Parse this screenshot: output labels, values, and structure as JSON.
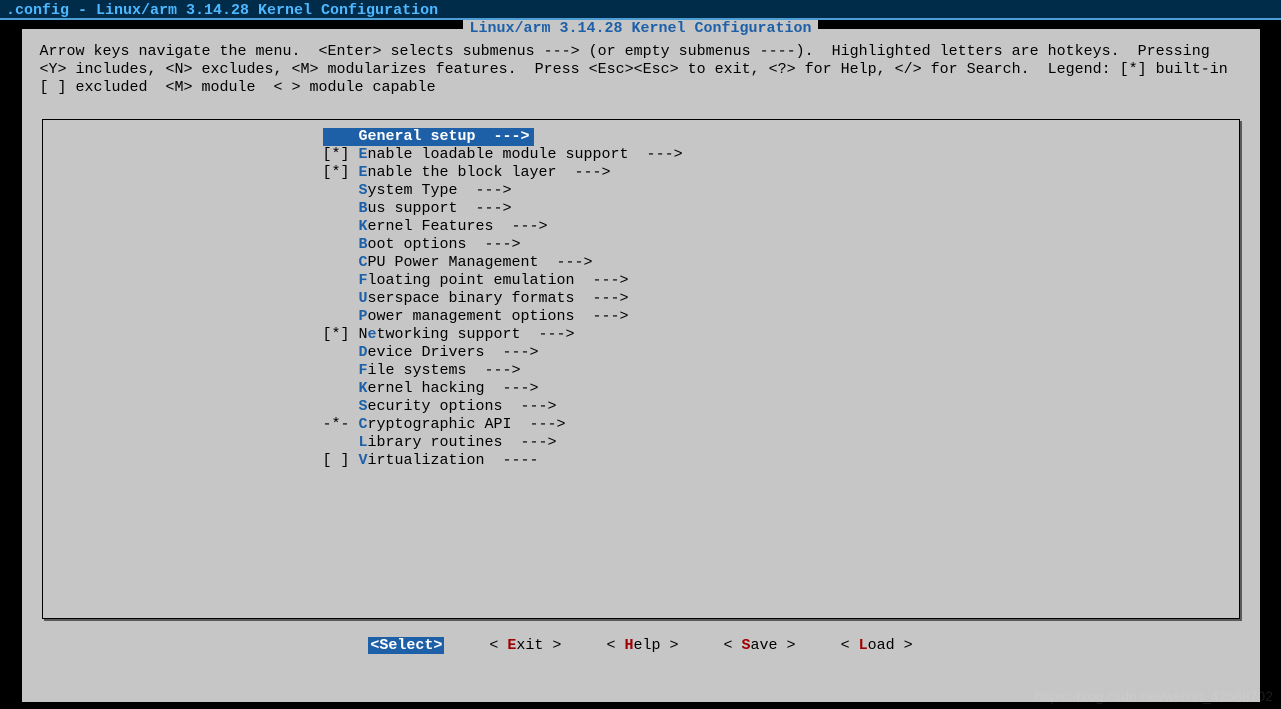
{
  "titlebar": ".config - Linux/arm 3.14.28 Kernel Configuration",
  "dialog_title": "Linux/arm 3.14.28 Kernel Configuration",
  "instructions": "Arrow keys navigate the menu.  <Enter> selects submenus ---> (or empty submenus ----).  Highlighted letters are hotkeys.  Pressing <Y> includes, <N> excludes, <M> modularizes features.  Press <Esc><Esc> to exit, <?> for Help, </> for Search.  Legend: [*] built-in  [ ] excluded  <M> module  < > module capable",
  "menu": [
    {
      "prefix": "    ",
      "hotkey": "G",
      "rest": "eneral setup  --->",
      "selected": true
    },
    {
      "prefix": "[*] ",
      "hotkey": "E",
      "rest": "nable loadable module support  --->",
      "selected": false
    },
    {
      "prefix": "[*] ",
      "hotkey": "E",
      "rest": "nable the block layer  --->",
      "selected": false
    },
    {
      "prefix": "    ",
      "hotkey": "S",
      "rest": "ystem Type  --->",
      "selected": false
    },
    {
      "prefix": "    ",
      "hotkey": "B",
      "rest": "us support  --->",
      "selected": false
    },
    {
      "prefix": "    ",
      "hotkey": "K",
      "rest": "ernel Features  --->",
      "selected": false
    },
    {
      "prefix": "    ",
      "hotkey": "B",
      "rest": "oot options  --->",
      "selected": false
    },
    {
      "prefix": "    ",
      "hotkey": "C",
      "rest": "PU Power Management  --->",
      "selected": false
    },
    {
      "prefix": "    ",
      "hotkey": "F",
      "rest": "loating point emulation  --->",
      "selected": false
    },
    {
      "prefix": "    ",
      "hotkey": "U",
      "rest": "serspace binary formats  --->",
      "selected": false
    },
    {
      "prefix": "    ",
      "hotkey": "P",
      "rest": "ower management options  --->",
      "selected": false
    },
    {
      "prefix": "[*] ",
      "pretext": "N",
      "hotkey": "e",
      "rest": "tworking support  --->",
      "selected": false
    },
    {
      "prefix": "    ",
      "hotkey": "D",
      "rest": "evice Drivers  --->",
      "selected": false
    },
    {
      "prefix": "    ",
      "hotkey": "F",
      "rest": "ile systems  --->",
      "selected": false
    },
    {
      "prefix": "    ",
      "hotkey": "K",
      "rest": "ernel hacking  --->",
      "selected": false
    },
    {
      "prefix": "    ",
      "hotkey": "S",
      "rest": "ecurity options  --->",
      "selected": false
    },
    {
      "prefix": "-*- ",
      "hotkey": "C",
      "rest": "ryptographic API  --->",
      "selected": false
    },
    {
      "prefix": "    ",
      "hotkey": "L",
      "rest": "ibrary routines  --->",
      "selected": false
    },
    {
      "prefix": "[ ] ",
      "hotkey": "V",
      "rest": "irtualization  ----",
      "selected": false
    }
  ],
  "buttons": {
    "select": {
      "full": "<Select>",
      "active": true
    },
    "exit": {
      "open": "< ",
      "hot": "E",
      "rest": "xit >"
    },
    "help": {
      "open": "< ",
      "hot": "H",
      "rest": "elp >"
    },
    "save": {
      "open": "< ",
      "hot": "S",
      "rest": "ave >"
    },
    "load": {
      "open": "< ",
      "hot": "L",
      "rest": "oad >"
    }
  },
  "watermark": "https://blog.csdn.net/weixin_42588702"
}
